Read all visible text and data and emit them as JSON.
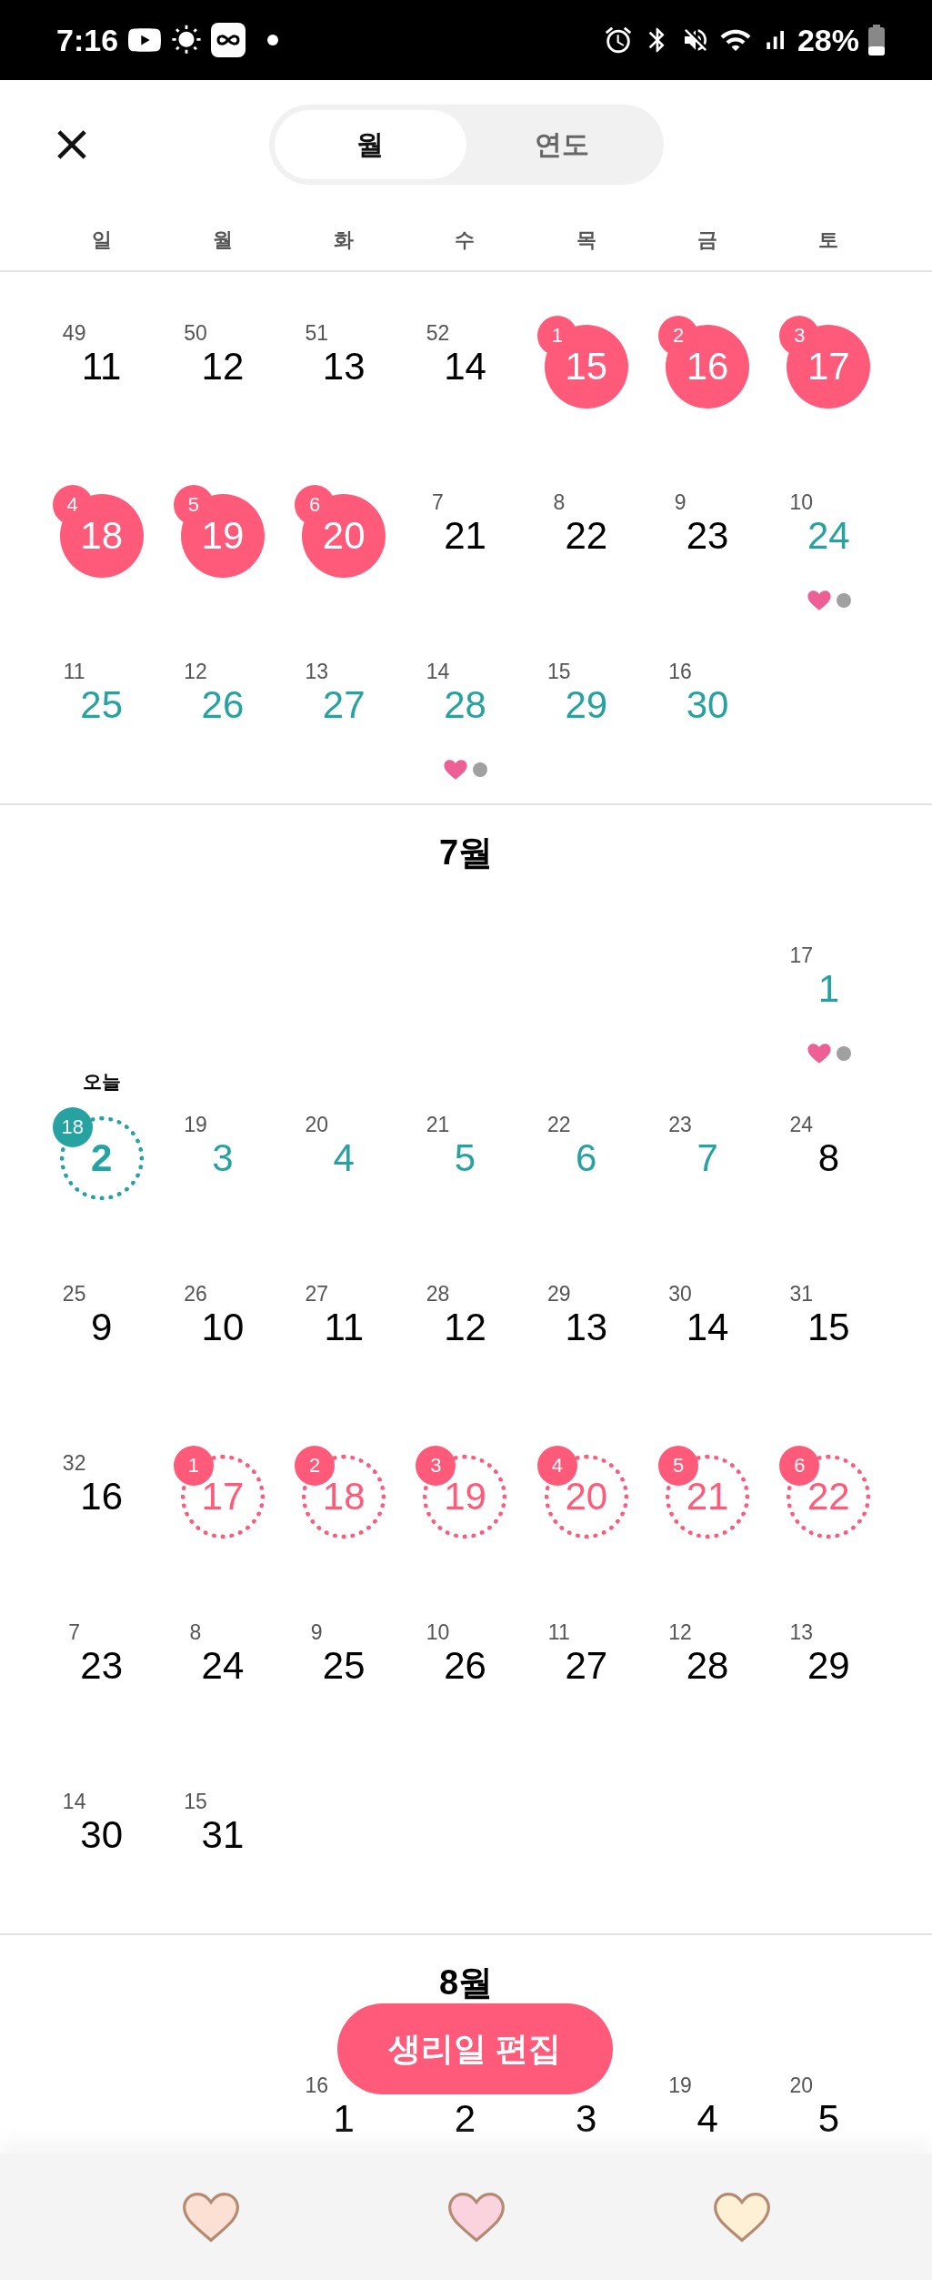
{
  "status_bar": {
    "time": "7:16",
    "battery": "28%"
  },
  "header": {
    "tabs": [
      {
        "label": "월",
        "selected": true
      },
      {
        "label": "연도",
        "selected": false
      }
    ]
  },
  "weekdays": [
    "일",
    "월",
    "화",
    "수",
    "목",
    "금",
    "토"
  ],
  "months": [
    {
      "weeks": [
        [
          {
            "kind": "normal",
            "day": "11",
            "cycle": "49",
            "markers": false
          },
          {
            "kind": "normal",
            "day": "12",
            "cycle": "50",
            "markers": false
          },
          {
            "kind": "normal",
            "day": "13",
            "cycle": "51",
            "markers": false
          },
          {
            "kind": "normal",
            "day": "14",
            "cycle": "52",
            "markers": false
          },
          {
            "kind": "period",
            "day": "15",
            "cycle": "1",
            "markers": false
          },
          {
            "kind": "period",
            "day": "16",
            "cycle": "2",
            "markers": false
          },
          {
            "kind": "period",
            "day": "17",
            "cycle": "3",
            "markers": false
          }
        ],
        [
          {
            "kind": "period",
            "day": "18",
            "cycle": "4",
            "markers": false
          },
          {
            "kind": "period",
            "day": "19",
            "cycle": "5",
            "markers": false
          },
          {
            "kind": "period",
            "day": "20",
            "cycle": "6",
            "markers": false
          },
          {
            "kind": "normal",
            "day": "21",
            "cycle": "7",
            "markers": false
          },
          {
            "kind": "normal",
            "day": "22",
            "cycle": "8",
            "markers": false
          },
          {
            "kind": "normal",
            "day": "23",
            "cycle": "9",
            "markers": false
          },
          {
            "kind": "fertile",
            "day": "24",
            "cycle": "10",
            "markers": true
          }
        ],
        [
          {
            "kind": "fertile",
            "day": "25",
            "cycle": "11",
            "markers": false
          },
          {
            "kind": "fertile",
            "day": "26",
            "cycle": "12",
            "markers": false
          },
          {
            "kind": "fertile",
            "day": "27",
            "cycle": "13",
            "markers": false
          },
          {
            "kind": "fertile",
            "day": "28",
            "cycle": "14",
            "markers": true
          },
          {
            "kind": "fertile",
            "day": "29",
            "cycle": "15",
            "markers": false
          },
          {
            "kind": "fertile",
            "day": "30",
            "cycle": "16",
            "markers": false
          },
          {
            "kind": "empty"
          }
        ]
      ]
    },
    {
      "title": "7월",
      "weeks": [
        [
          {
            "kind": "empty"
          },
          {
            "kind": "empty"
          },
          {
            "kind": "empty"
          },
          {
            "kind": "empty"
          },
          {
            "kind": "empty"
          },
          {
            "kind": "empty"
          },
          {
            "kind": "fertile",
            "day": "1",
            "cycle": "17",
            "markers": true
          }
        ],
        [
          {
            "kind": "today",
            "day": "2",
            "cycle": "18",
            "markers": false,
            "label": "오늘"
          },
          {
            "kind": "fertile",
            "day": "3",
            "cycle": "19",
            "markers": false
          },
          {
            "kind": "fertile",
            "day": "4",
            "cycle": "20",
            "markers": false
          },
          {
            "kind": "fertile",
            "day": "5",
            "cycle": "21",
            "markers": false
          },
          {
            "kind": "fertile",
            "day": "6",
            "cycle": "22",
            "markers": false
          },
          {
            "kind": "fertile",
            "day": "7",
            "cycle": "23",
            "markers": false
          },
          {
            "kind": "normal",
            "day": "8",
            "cycle": "24",
            "markers": false
          }
        ],
        [
          {
            "kind": "normal",
            "day": "9",
            "cycle": "25",
            "markers": false
          },
          {
            "kind": "normal",
            "day": "10",
            "cycle": "26",
            "markers": false
          },
          {
            "kind": "normal",
            "day": "11",
            "cycle": "27",
            "markers": false
          },
          {
            "kind": "normal",
            "day": "12",
            "cycle": "28",
            "markers": false
          },
          {
            "kind": "normal",
            "day": "13",
            "cycle": "29",
            "markers": false
          },
          {
            "kind": "normal",
            "day": "14",
            "cycle": "30",
            "markers": false
          },
          {
            "kind": "normal",
            "day": "15",
            "cycle": "31",
            "markers": false
          }
        ],
        [
          {
            "kind": "normal",
            "day": "16",
            "cycle": "32",
            "markers": false
          },
          {
            "kind": "predicted",
            "day": "17",
            "cycle": "1",
            "markers": false
          },
          {
            "kind": "predicted",
            "day": "18",
            "cycle": "2",
            "markers": false
          },
          {
            "kind": "predicted",
            "day": "19",
            "cycle": "3",
            "markers": false
          },
          {
            "kind": "predicted",
            "day": "20",
            "cycle": "4",
            "markers": false
          },
          {
            "kind": "predicted",
            "day": "21",
            "cycle": "5",
            "markers": false
          },
          {
            "kind": "predicted",
            "day": "22",
            "cycle": "6",
            "markers": false
          }
        ],
        [
          {
            "kind": "normal",
            "day": "23",
            "cycle": "7",
            "markers": false
          },
          {
            "kind": "normal",
            "day": "24",
            "cycle": "8",
            "markers": false
          },
          {
            "kind": "normal",
            "day": "25",
            "cycle": "9",
            "markers": false
          },
          {
            "kind": "normal",
            "day": "26",
            "cycle": "10",
            "markers": false
          },
          {
            "kind": "normal",
            "day": "27",
            "cycle": "11",
            "markers": false
          },
          {
            "kind": "normal",
            "day": "28",
            "cycle": "12",
            "markers": false
          },
          {
            "kind": "normal",
            "day": "29",
            "cycle": "13",
            "markers": false
          }
        ],
        [
          {
            "kind": "normal",
            "day": "30",
            "cycle": "14",
            "markers": false
          },
          {
            "kind": "normal",
            "day": "31",
            "cycle": "15",
            "markers": false
          },
          {
            "kind": "empty"
          },
          {
            "kind": "empty"
          },
          {
            "kind": "empty"
          },
          {
            "kind": "empty"
          },
          {
            "kind": "empty"
          }
        ]
      ]
    },
    {
      "title": "8월",
      "weeks": [
        [
          {
            "kind": "empty"
          },
          {
            "kind": "empty"
          },
          {
            "kind": "normal",
            "day": "1",
            "cycle": "16",
            "markers": false
          },
          {
            "kind": "normal",
            "day": "2",
            "markers": false
          },
          {
            "kind": "normal",
            "day": "3",
            "markers": false
          },
          {
            "kind": "normal",
            "day": "4",
            "cycle": "19",
            "markers": false
          },
          {
            "kind": "normal",
            "day": "5",
            "cycle": "20",
            "markers": false
          }
        ]
      ]
    }
  ],
  "edit_button": "생리일 편집",
  "bottom_nav": [
    {
      "color": "#fde0d4"
    },
    {
      "color": "#fbd3df"
    },
    {
      "color": "#fdf0d4"
    }
  ]
}
